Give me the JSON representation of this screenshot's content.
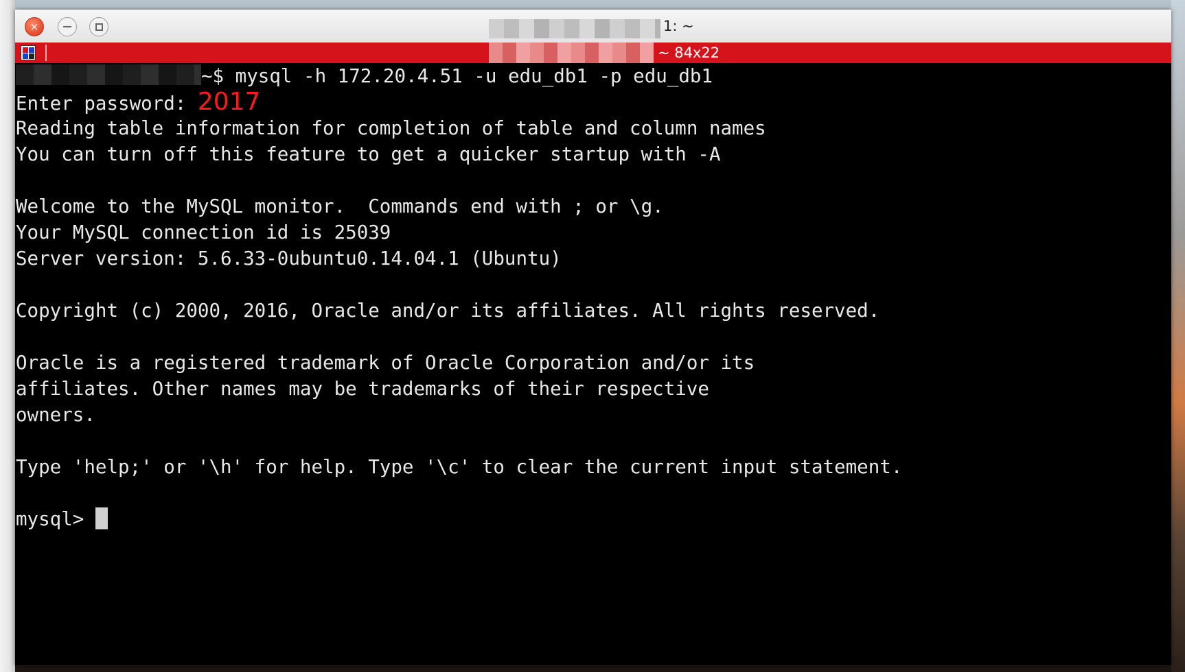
{
  "window": {
    "title_suffix": "1: ~",
    "tab_label": "~ 84x22",
    "buttons": {
      "close": "×"
    }
  },
  "terminal": {
    "prompt_suffix": "~$ ",
    "command": "mysql -h 172.20.4.51 -u edu_db1 -p edu_db1",
    "password_label": "Enter password: ",
    "password_value": "2017",
    "lines": [
      "Reading table information for completion of table and column names",
      "You can turn off this feature to get a quicker startup with -A",
      "",
      "Welcome to the MySQL monitor.  Commands end with ; or \\g.",
      "Your MySQL connection id is 25039",
      "Server version: 5.6.33-0ubuntu0.14.04.1 (Ubuntu)",
      "",
      "Copyright (c) 2000, 2016, Oracle and/or its affiliates. All rights reserved.",
      "",
      "Oracle is a registered trademark of Oracle Corporation and/or its",
      "affiliates. Other names may be trademarks of their respective",
      "owners.",
      "",
      "Type 'help;' or '\\h' for help. Type '\\c' to clear the current input statement.",
      ""
    ],
    "mysql_prompt": "mysql> "
  },
  "colors": {
    "tabbar": "#d4141a",
    "password": "#ff1a1a",
    "terminal_bg": "#000000",
    "terminal_fg": "#e8e8e8"
  }
}
